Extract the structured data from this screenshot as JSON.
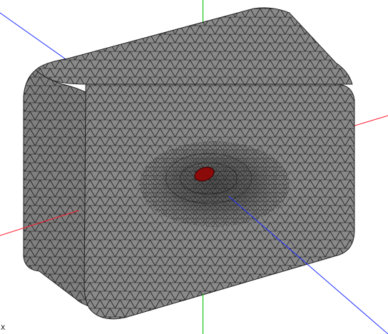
{
  "viewport": {
    "background": "#ffffff"
  },
  "axes": {
    "x_color": "#ff1a2e",
    "y_color": "#11c411",
    "z_color": "#1f2fff",
    "corner_label": "X"
  },
  "mesh": {
    "face_color": "#8a8a8a",
    "face_dark_color": "#6f6f6f",
    "wire_color": "#111111",
    "hotspot_color": "#8b0a0a"
  }
}
